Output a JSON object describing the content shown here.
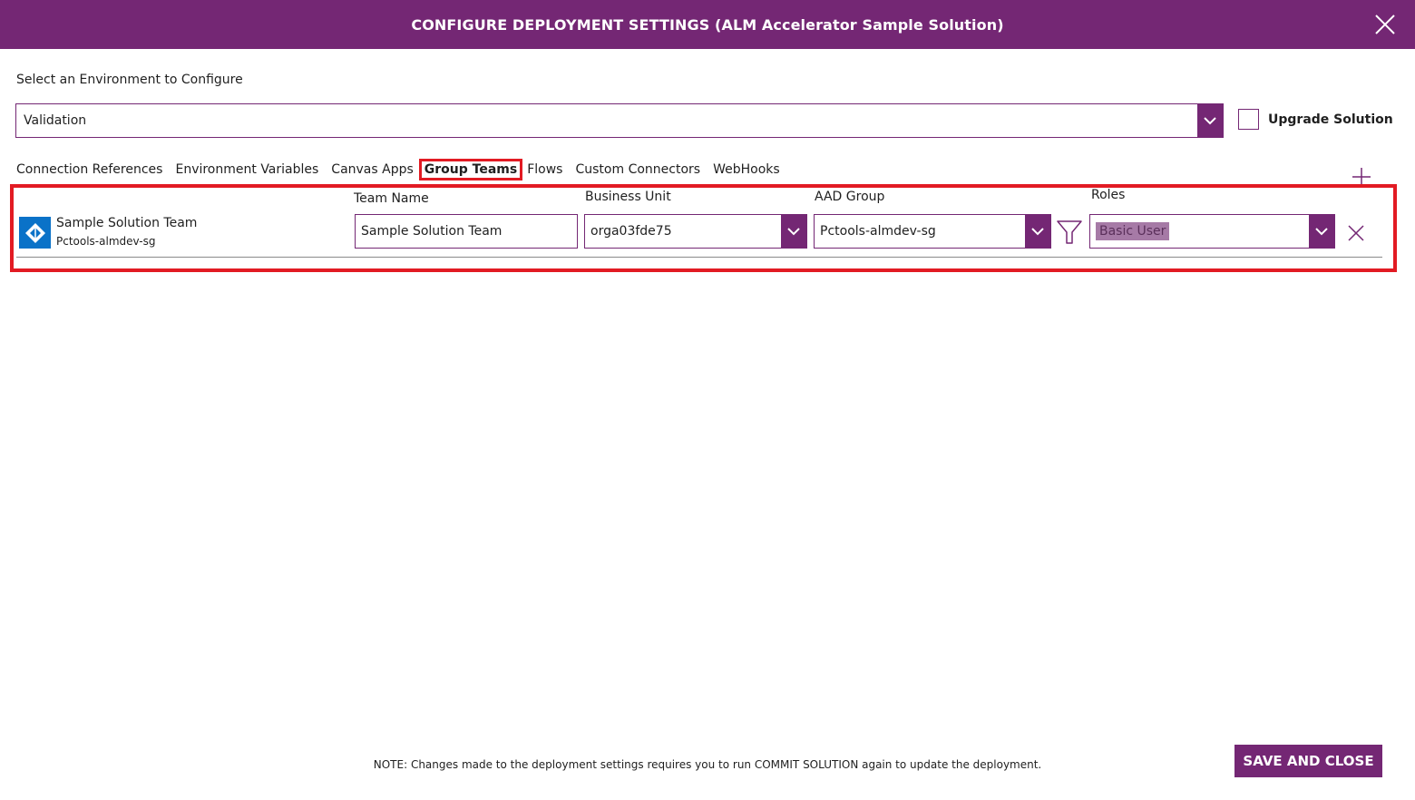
{
  "header": {
    "title": "CONFIGURE DEPLOYMENT SETTINGS (ALM Accelerator Sample Solution)",
    "close_icon": "close-icon"
  },
  "environment": {
    "label": "Select an Environment to Configure",
    "selected": "Validation"
  },
  "upgrade": {
    "label": "Upgrade Solution",
    "checked": false
  },
  "tabs": [
    {
      "label": "Connection References",
      "active": false
    },
    {
      "label": "Environment Variables",
      "active": false
    },
    {
      "label": "Canvas Apps",
      "active": false
    },
    {
      "label": "Group Teams",
      "active": true
    },
    {
      "label": "Flows",
      "active": false
    },
    {
      "label": "Custom Connectors",
      "active": false
    },
    {
      "label": "WebHooks",
      "active": false
    }
  ],
  "group_team": {
    "icon": "azure-ad-group-icon",
    "name": "Sample Solution Team",
    "subtitle": "Pctools-almdev-sg",
    "columns": {
      "team_name": "Team Name",
      "business_unit": "Business Unit",
      "aad_group": "AAD Group",
      "roles": "Roles"
    },
    "values": {
      "team_name": "Sample Solution Team",
      "business_unit": "orga03fde75",
      "aad_group": "Pctools-almdev-sg",
      "roles": "Basic User"
    }
  },
  "footer": {
    "note": "NOTE: Changes made to the deployment settings requires you to run COMMIT SOLUTION again to update the deployment.",
    "save_label": "SAVE AND CLOSE"
  },
  "colors": {
    "brand": "#742774",
    "highlight": "#e21b23",
    "role_chip": "#a67aa6",
    "aad_icon": "#0a72c8"
  }
}
